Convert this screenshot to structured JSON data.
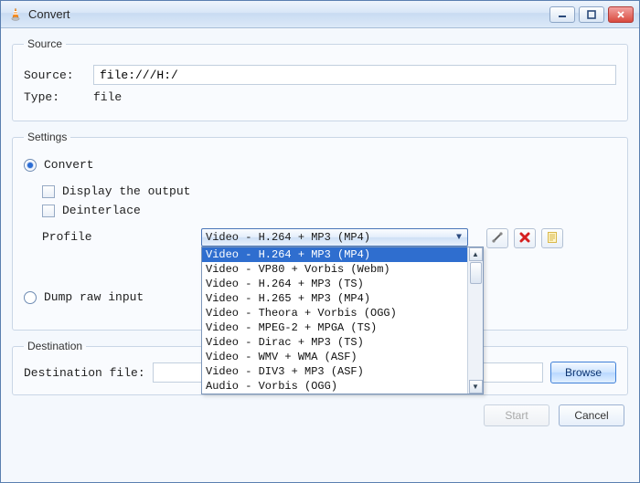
{
  "titlebar": {
    "title": "Convert"
  },
  "source": {
    "legend": "Source",
    "source_label": "Source:",
    "source_value": "file:///H:/",
    "type_label": "Type:",
    "type_value": "file"
  },
  "settings": {
    "legend": "Settings",
    "convert_label": "Convert",
    "display_output_label": "Display the output",
    "deinterlace_label": "Deinterlace",
    "profile_label": "Profile",
    "profile_selected": "Video - H.264 + MP3 (MP4)",
    "profile_options": [
      "Video - H.264 + MP3 (MP4)",
      "Video - VP80 + Vorbis (Webm)",
      "Video - H.264 + MP3 (TS)",
      "Video - H.265 + MP3 (MP4)",
      "Video - Theora + Vorbis (OGG)",
      "Video - MPEG-2 + MPGA (TS)",
      "Video - Dirac + MP3 (TS)",
      "Video - WMV + WMA (ASF)",
      "Video - DIV3 + MP3 (ASF)",
      "Audio - Vorbis (OGG)"
    ],
    "dump_raw_label": "Dump raw input",
    "icons": {
      "edit": "edit-profile",
      "delete": "delete-profile",
      "new": "new-profile"
    }
  },
  "destination": {
    "legend": "Destination",
    "file_label": "Destination file:",
    "file_value": "",
    "browse_label": "Browse"
  },
  "footer": {
    "start_label": "Start",
    "cancel_label": "Cancel"
  }
}
